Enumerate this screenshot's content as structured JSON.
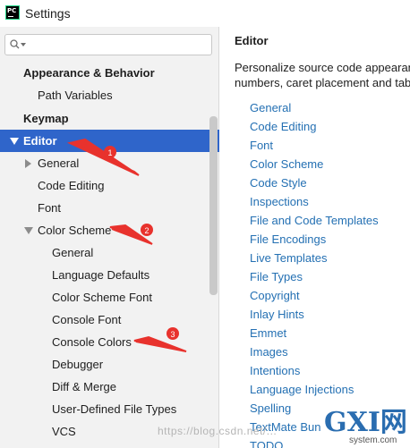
{
  "window": {
    "title": "Settings",
    "app_icon_text": "PC"
  },
  "search": {
    "placeholder": "",
    "value": ""
  },
  "tree": {
    "appearance": "Appearance & Behavior",
    "path_variables": "Path Variables",
    "keymap": "Keymap",
    "editor": "Editor",
    "general": "General",
    "code_editing": "Code Editing",
    "font": "Font",
    "color_scheme": "Color Scheme",
    "cs_general": "General",
    "language_defaults": "Language Defaults",
    "color_scheme_font": "Color Scheme Font",
    "console_font": "Console Font",
    "console_colors": "Console Colors",
    "debugger": "Debugger",
    "diff_merge": "Diff & Merge",
    "user_defined_file_types": "User-Defined File Types",
    "vcs": "VCS"
  },
  "main": {
    "title": "Editor",
    "description_line1": "Personalize source code appearanc",
    "description_line2": "numbers, caret placement and tab",
    "links": [
      "General",
      "Code Editing",
      "Font",
      "Color Scheme",
      "Code Style",
      "Inspections",
      "File and Code Templates",
      "File Encodings",
      "Live Templates",
      "File Types",
      "Copyright",
      "Inlay Hints",
      "Emmet",
      "Images",
      "Intentions",
      "Language Injections",
      "Spelling",
      "TextMate Bun",
      "TODO"
    ]
  },
  "annotations": {
    "marker1": "1",
    "marker2": "2",
    "marker3": "3"
  },
  "watermark": {
    "text": "https://blog.csdn.net/...",
    "logo_text": "GXI网",
    "logo_sub": "system.com"
  },
  "colors": {
    "selection": "#2f65ca",
    "link": "#2470b3",
    "arrow": "#e8322d"
  }
}
